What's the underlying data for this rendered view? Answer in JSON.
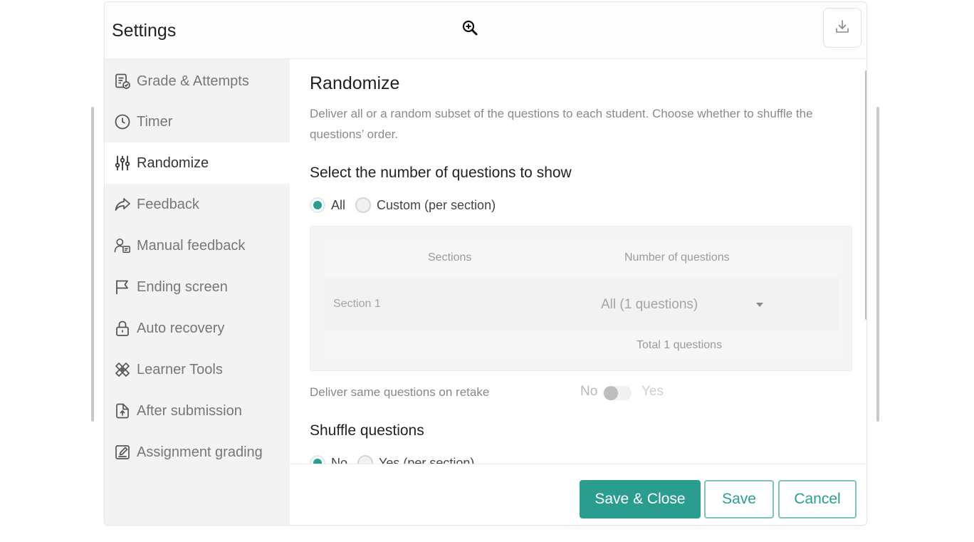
{
  "dialog": {
    "title": "Settings",
    "icons": {
      "zoom": "zoom-in-icon",
      "download": "download-icon"
    }
  },
  "sidebar": {
    "items": [
      {
        "label": "Grade & Attempts",
        "icon": "grade-icon",
        "active": false
      },
      {
        "label": "Timer",
        "icon": "clock-icon",
        "active": false
      },
      {
        "label": "Randomize",
        "icon": "sliders-icon",
        "active": true
      },
      {
        "label": "Feedback",
        "icon": "share-arrow-icon",
        "active": false
      },
      {
        "label": "Manual feedback",
        "icon": "user-feedback-icon",
        "active": false
      },
      {
        "label": "Ending screen",
        "icon": "flag-icon",
        "active": false
      },
      {
        "label": "Auto recovery",
        "icon": "lock-icon",
        "active": false
      },
      {
        "label": "Learner Tools",
        "icon": "tools-icon",
        "active": false
      },
      {
        "label": "After submission",
        "icon": "upload-doc-icon",
        "active": false
      },
      {
        "label": "Assignment grading",
        "icon": "edit-icon",
        "active": false
      }
    ]
  },
  "content": {
    "title": "Randomize",
    "description": "Deliver all or a random subset of the questions to each student. Choose whether to shuffle the questions’ order.",
    "select_section": {
      "title": "Select the number of questions to show",
      "options": [
        {
          "label": "All",
          "checked": true
        },
        {
          "label": "Custom (per section)",
          "checked": false
        }
      ]
    },
    "table": {
      "headers": [
        "Sections",
        "Number of questions"
      ],
      "rows": [
        {
          "section": "Section 1",
          "value": "All (1 questions)"
        }
      ],
      "total": "Total 1 questions"
    },
    "retake": {
      "label": "Deliver same questions on retake",
      "off_label": "No",
      "on_label": "Yes",
      "on": false
    },
    "shuffle_section": {
      "title": "Shuffle questions",
      "options": [
        {
          "label": "No",
          "checked": true
        },
        {
          "label": "Yes (per section)",
          "checked": false
        }
      ]
    }
  },
  "footer": {
    "save_close_label": "Save & Close",
    "save_label": "Save",
    "cancel_label": "Cancel"
  },
  "colors": {
    "accent": "#2a9d8f",
    "sidebar_bg": "#f3f3f3",
    "muted_text": "#8a8a8a"
  }
}
